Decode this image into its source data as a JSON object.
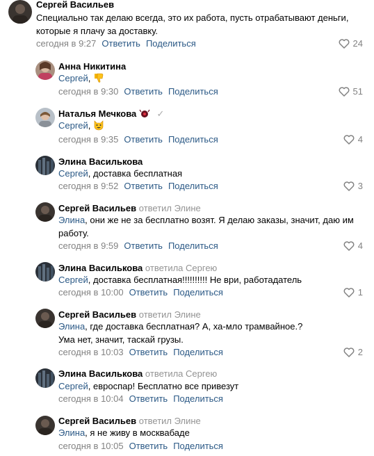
{
  "comments": [
    {
      "author": "Сергей Васильев",
      "text": "Специально так делаю всегда, это их работа, пусть отрабатывают деньги, которые я плачу за доставку.",
      "time": "сегодня в 9:27",
      "reply": "Ответить",
      "share": "Поделиться",
      "likes": "24"
    },
    {
      "author": "Анна Никитина",
      "mention": "Сергей",
      "text": ",",
      "emoji": "thumbs-down",
      "time": "сегодня в 9:30",
      "reply": "Ответить",
      "share": "Поделиться",
      "likes": "51"
    },
    {
      "author": "Наталья Мечкова",
      "mention": "Сергей",
      "text": ",",
      "emoji": "grinning-cat",
      "time": "сегодня в 9:35",
      "reply": "Ответить",
      "share": "Поделиться",
      "likes": "4"
    },
    {
      "author": "Элина Василькова",
      "mention": "Сергей",
      "text": ", доставка бесплатная",
      "time": "сегодня в 9:52",
      "reply": "Ответить",
      "share": "Поделиться",
      "likes": "3"
    },
    {
      "author": "Сергей Васильев",
      "reply_to": "ответил Элине",
      "mention": "Элина",
      "text": ", они же не за бесплатно возят. Я делаю заказы, значит, даю им работу.",
      "time": "сегодня в 9:59",
      "reply": "Ответить",
      "share": "Поделиться",
      "likes": "4"
    },
    {
      "author": "Элина Василькова",
      "reply_to": "ответила Сергею",
      "mention": "Сергей",
      "text": ", доставка бесплатная!!!!!!!!!! Не ври, работадатель",
      "time": "сегодня в 10:00",
      "reply": "Ответить",
      "share": "Поделиться",
      "likes": "1"
    },
    {
      "author": "Сергей Васильев",
      "reply_to": "ответил Элине",
      "mention": "Элина",
      "text": ", где доставка бесплатная? А, ха-мло трамвайное.?",
      "text2": "Ума нет, значит, таскай грузы.",
      "time": "сегодня в 10:03",
      "reply": "Ответить",
      "share": "Поделиться",
      "likes": "2"
    },
    {
      "author": "Элина Василькова",
      "reply_to": "ответила Сергею",
      "mention": "Сергей",
      "text": ", евроспар! Бесплатно все привезут",
      "time": "сегодня в 10:04",
      "reply": "Ответить",
      "share": "Поделиться"
    },
    {
      "author": "Сергей Васильев",
      "reply_to": "ответил Элине",
      "mention": "Элина",
      "text": ", я не живу в москвабаде",
      "time": "сегодня в 10:05",
      "reply": "Ответить",
      "share": "Поделиться"
    }
  ],
  "colors": {
    "link": "#2a5885",
    "meta": "#828282"
  }
}
